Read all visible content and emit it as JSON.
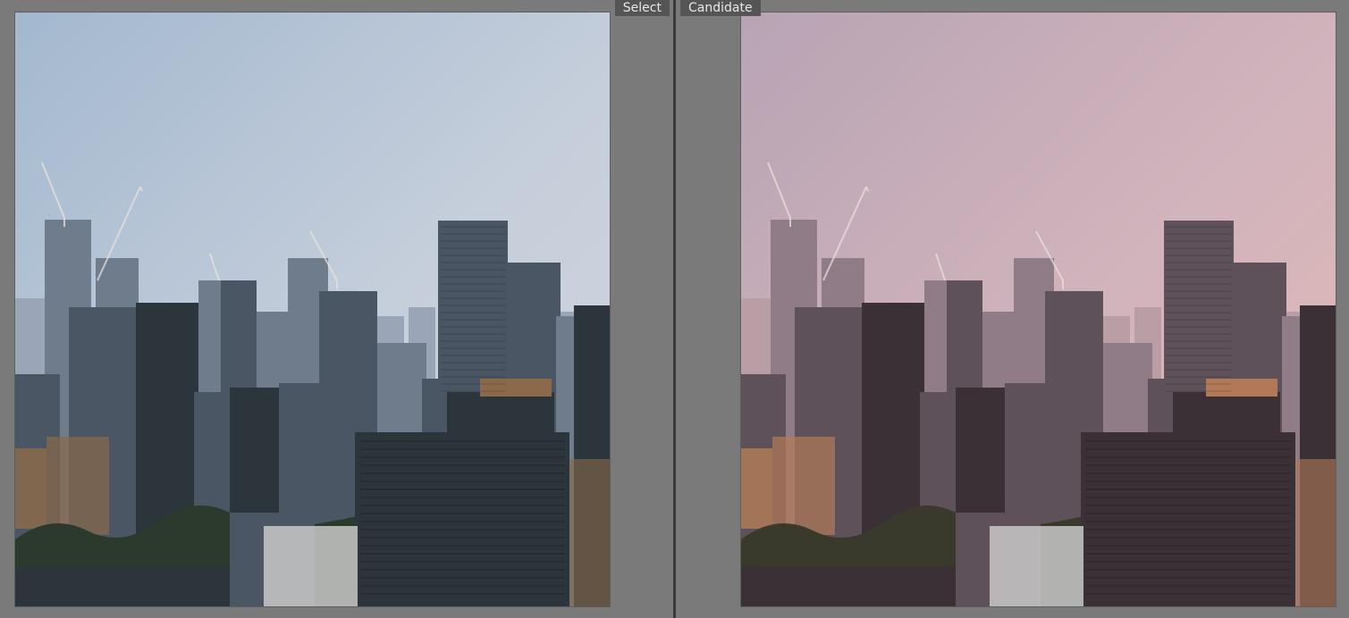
{
  "compare": {
    "select": {
      "label": "Select",
      "tint": "cool",
      "colors": {
        "sky_top": "#a3b8cf",
        "sky_mid": "#c5cedb",
        "sky_bottom": "#d4d5dd",
        "haze": "#9aa6b7",
        "far": "#6f7c8c",
        "mid": "#4a5663",
        "near": "#2c343c",
        "warm_accent": "#8a6a4a",
        "trees": "#2b3a2c"
      }
    },
    "candidate": {
      "label": "Candidate",
      "tint": "warm",
      "colors": {
        "sky_top": "#b8a4b4",
        "sky_mid": "#d2b4bc",
        "sky_bottom": "#e2b9b6",
        "haze": "#b99ea6",
        "far": "#8f7c86",
        "mid": "#5f5159",
        "near": "#3a3035",
        "warm_accent": "#b07a58",
        "trees": "#3a3a2c"
      }
    }
  }
}
